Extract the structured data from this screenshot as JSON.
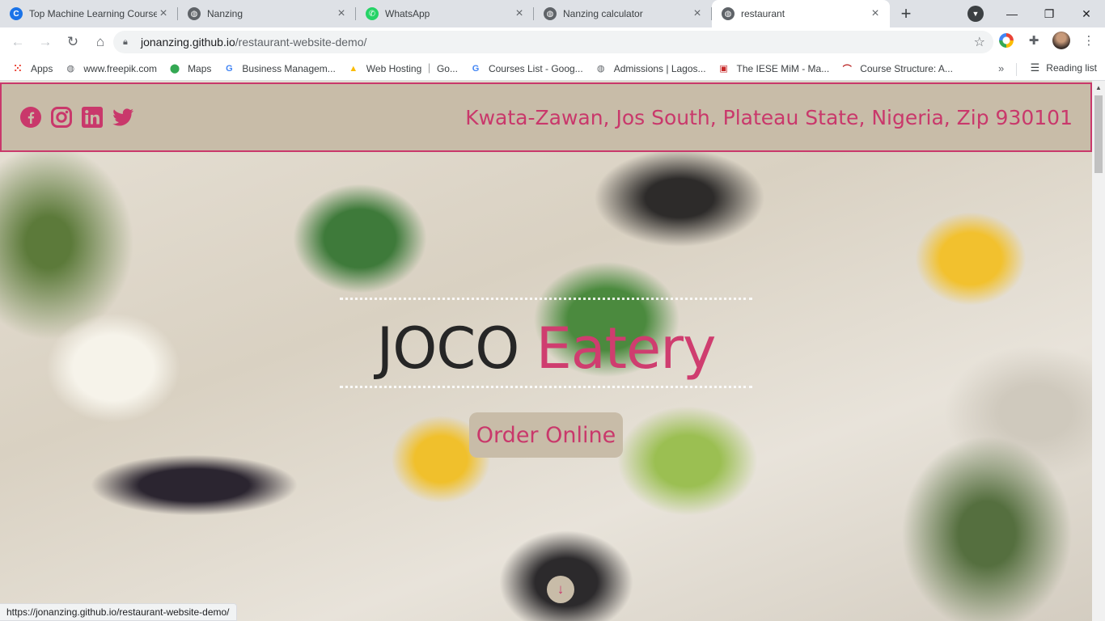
{
  "browser": {
    "tabs": [
      {
        "title": "Top Machine Learning Course",
        "favicon": "coursera-icon",
        "color": "#1a73e8"
      },
      {
        "title": "Nanzing",
        "favicon": "globe-icon",
        "color": "#5f6368"
      },
      {
        "title": "WhatsApp",
        "favicon": "whatsapp-icon",
        "color": "#25d366"
      },
      {
        "title": "Nanzing calculator",
        "favicon": "globe-icon",
        "color": "#5f6368"
      },
      {
        "title": "restaurant",
        "favicon": "globe-icon",
        "color": "#5f6368",
        "active": true
      }
    ],
    "url_host": "jonanzing.github.io",
    "url_path": "/restaurant-website-demo/",
    "bookmarks": [
      {
        "label": "Apps",
        "icon": "apps-grid-icon"
      },
      {
        "label": "www.freepik.com",
        "icon": "globe-icon"
      },
      {
        "label": "Maps",
        "icon": "maps-pin-icon"
      },
      {
        "label": "Business Managem...",
        "icon": "google-icon"
      },
      {
        "label": "Web Hosting ｜ Go...",
        "icon": "drive-icon"
      },
      {
        "label": "Courses List - Goog...",
        "icon": "google-icon"
      },
      {
        "label": "Admissions | Lagos...",
        "icon": "globe-icon"
      },
      {
        "label": "The IESE MiM - Ma...",
        "icon": "iese-icon"
      },
      {
        "label": "Course Structure: A...",
        "icon": "arch-icon"
      }
    ],
    "more_bookmarks": "»",
    "reading_list": "Reading list",
    "status_url": "https://jonanzing.github.io/restaurant-website-demo/"
  },
  "page": {
    "social": [
      "facebook-icon",
      "instagram-icon",
      "linkedin-icon",
      "twitter-icon"
    ],
    "address": "Kwata-Zawan, Jos South, Plateau State, Nigeria, Zip 930101",
    "title_part1": "JOCO",
    "title_part2": "Eatery",
    "order_button": "Order Online",
    "accent_color": "#c9386b",
    "panel_color": "#c8bca8"
  }
}
